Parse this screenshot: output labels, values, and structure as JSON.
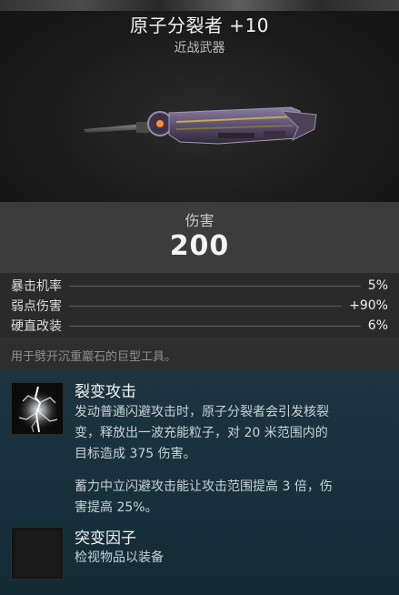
{
  "weapon": {
    "name": "原子分裂者 +10",
    "type": "近战武器"
  },
  "damage": {
    "label": "伤害",
    "value": "200"
  },
  "stats": [
    {
      "name": "暴击机率",
      "value": "5%"
    },
    {
      "name": "弱点伤害",
      "value": "+90%"
    },
    {
      "name": "硬直改装",
      "value": "6%"
    }
  ],
  "description": "用于劈开沉重巖石的巨型工具。",
  "mod": {
    "title": "裂变攻击",
    "lines": [
      "发动普通闪避攻击时，原子分裂者会引发核裂",
      "变，释放出一波充能粒子，对 20 米范围内的",
      "目标造成 375 伤害。",
      "蓄力中立闪避攻击能让攻击范围提高 3 倍，伤",
      "害提高 25%。"
    ],
    "icon": "lightning-burst-icon"
  },
  "mutator": {
    "title": "突变因子",
    "text": "检视物品以装备",
    "icon": "empty-slot-icon"
  },
  "colors": {
    "ability_bg": "#1d3440",
    "damage_bg": "#3c3c3c",
    "stats_bg": "#2a2a2a"
  }
}
